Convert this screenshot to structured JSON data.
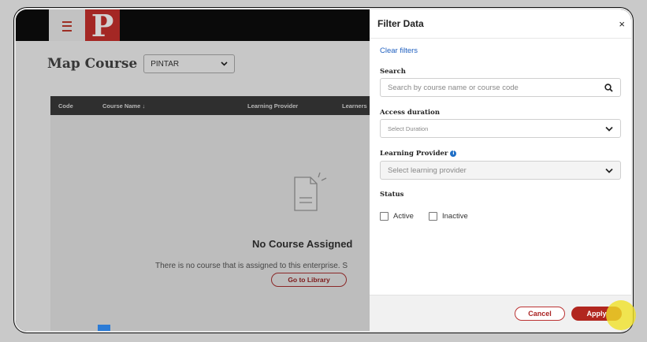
{
  "app": {
    "logo_letter": "P"
  },
  "page": {
    "title": "Map Course",
    "enterprise_select": "PINTAR"
  },
  "table": {
    "columns": [
      "Code",
      "Course Name",
      "Learning Provider",
      "Learners"
    ],
    "sort_indicator": "↓"
  },
  "empty_state": {
    "icon": "document-icon",
    "title": "No Course Assigned",
    "description": "There is no course that is assigned to this enterprise. S",
    "button_label": "Go to Library"
  },
  "filter_panel": {
    "title": "Filter Data",
    "close_glyph": "×",
    "clear_label": "Clear filters",
    "search": {
      "label": "Search",
      "placeholder": "Search by course name or course code"
    },
    "access_duration": {
      "label": "Access duration",
      "placeholder": "Select Duration"
    },
    "learning_provider": {
      "label": "Learning Provider",
      "placeholder": "Select learning provider"
    },
    "status": {
      "label": "Status",
      "options": [
        {
          "label": "Active",
          "checked": false
        },
        {
          "label": "Inactive",
          "checked": false
        }
      ]
    },
    "cancel_label": "Cancel",
    "apply_label": "Apply"
  },
  "colors": {
    "brand": "#c9302c",
    "link": "#1f5fbf",
    "accent_button": "#b1261f"
  }
}
